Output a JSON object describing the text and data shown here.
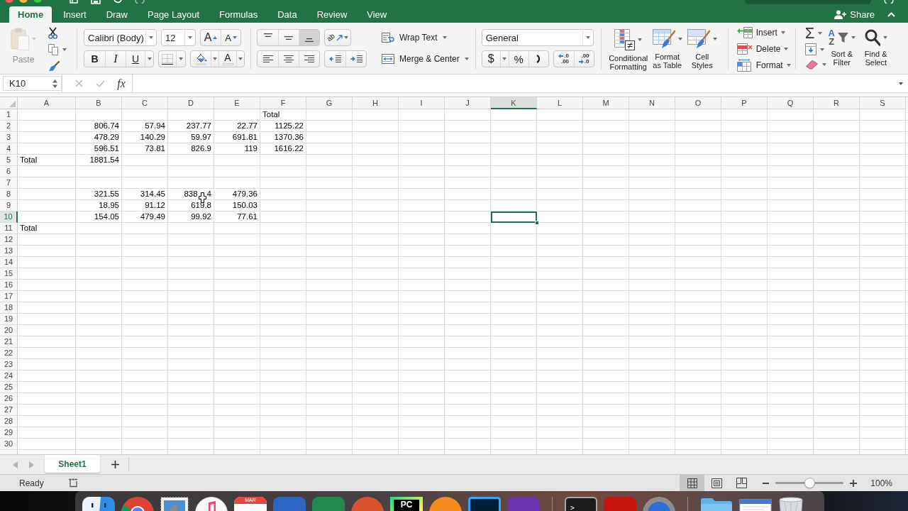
{
  "ribbon_tabs": [
    {
      "label": "Home",
      "selected": true
    },
    {
      "label": "Insert",
      "selected": false
    },
    {
      "label": "Draw",
      "selected": false
    },
    {
      "label": "Page Layout",
      "selected": false
    },
    {
      "label": "Formulas",
      "selected": false
    },
    {
      "label": "Data",
      "selected": false
    },
    {
      "label": "Review",
      "selected": false
    },
    {
      "label": "View",
      "selected": false
    }
  ],
  "share": {
    "label": "Share"
  },
  "ribbon": {
    "clipboard": {
      "paste": {
        "label": "Paste",
        "disabled": true
      }
    },
    "font": {
      "name": "Calibri (Body)",
      "size": "12",
      "grow": "A",
      "shrink": "A",
      "bold": "B",
      "italic": "I",
      "underline": "U",
      "font_color": "A"
    },
    "alignment": {
      "vertical": [
        {
          "kind": "top",
          "selected": false
        },
        {
          "kind": "middle",
          "selected": false
        },
        {
          "kind": "bottom",
          "selected": true
        }
      ],
      "orientation": "ab",
      "horizontal": [
        {
          "kind": "left",
          "selected": false
        },
        {
          "kind": "center",
          "selected": false
        },
        {
          "kind": "right",
          "selected": false
        }
      ],
      "wrap_text": "Wrap Text",
      "merge": "Merge & Center"
    },
    "number": {
      "format": "General",
      "currency": "$",
      "percent": "%",
      "decimals": [
        {
          "kind": "increase",
          "top": ".0",
          "bottom": ".00"
        },
        {
          "kind": "decrease",
          "top": ".00",
          "bottom": ".0"
        }
      ]
    },
    "styles": [
      {
        "kind": "conditional",
        "label": "Conditional Formatting"
      },
      {
        "kind": "table",
        "label": "Format as Table"
      },
      {
        "kind": "cell",
        "label": "Cell Styles"
      }
    ],
    "cells": [
      {
        "kind": "insert",
        "label": "Insert"
      },
      {
        "kind": "delete",
        "label": "Delete"
      },
      {
        "kind": "format",
        "label": "Format"
      }
    ],
    "editing": {
      "sum": "Σ",
      "sort": {
        "letters": [
          "A",
          "Z"
        ],
        "label": "Sort & Filter"
      },
      "find": {
        "label": "Find & Select"
      }
    }
  },
  "formula_bar": {
    "name_box": "K10",
    "cancel": {
      "disabled": true
    },
    "enter": {
      "disabled": true
    },
    "function_label": "fx"
  },
  "sheet": {
    "columns": [
      {
        "label": "A",
        "selected": false
      },
      {
        "label": "B",
        "selected": false
      },
      {
        "label": "C",
        "selected": false
      },
      {
        "label": "D",
        "selected": false
      },
      {
        "label": "E",
        "selected": false
      },
      {
        "label": "F",
        "selected": false
      },
      {
        "label": "G",
        "selected": false
      },
      {
        "label": "H",
        "selected": false
      },
      {
        "label": "I",
        "selected": false
      },
      {
        "label": "J",
        "selected": false
      },
      {
        "label": "K",
        "selected": true
      },
      {
        "label": "L",
        "selected": false
      },
      {
        "label": "M",
        "selected": false
      },
      {
        "label": "N",
        "selected": false
      },
      {
        "label": "O",
        "selected": false
      },
      {
        "label": "P",
        "selected": false
      },
      {
        "label": "Q",
        "selected": false
      },
      {
        "label": "R",
        "selected": false
      },
      {
        "label": "S",
        "selected": false
      }
    ],
    "rows": [
      {
        "label": "1",
        "selected": false,
        "cells": [
          null,
          null,
          null,
          null,
          null,
          {
            "value": "Total",
            "kind": "text"
          }
        ]
      },
      {
        "label": "2",
        "selected": false,
        "cells": [
          null,
          {
            "value": "806.74",
            "kind": "number"
          },
          {
            "value": "57.94",
            "kind": "number"
          },
          {
            "value": "237.77",
            "kind": "number"
          },
          {
            "value": "22.77",
            "kind": "number"
          },
          {
            "value": "1125.22",
            "kind": "number"
          }
        ]
      },
      {
        "label": "3",
        "selected": false,
        "cells": [
          null,
          {
            "value": "478.29",
            "kind": "number"
          },
          {
            "value": "140.29",
            "kind": "number"
          },
          {
            "value": "59.97",
            "kind": "number"
          },
          {
            "value": "691.81",
            "kind": "number"
          },
          {
            "value": "1370.36",
            "kind": "number"
          }
        ]
      },
      {
        "label": "4",
        "selected": false,
        "cells": [
          null,
          {
            "value": "596.51",
            "kind": "number"
          },
          {
            "value": "73.81",
            "kind": "number"
          },
          {
            "value": "826.9",
            "kind": "number"
          },
          {
            "value": "119",
            "kind": "number"
          },
          {
            "value": "1616.22",
            "kind": "number"
          }
        ]
      },
      {
        "label": "5",
        "selected": false,
        "cells": [
          {
            "value": "Total",
            "kind": "text"
          },
          {
            "value": "1881.54",
            "kind": "number"
          }
        ]
      },
      {
        "label": "6",
        "selected": false
      },
      {
        "label": "7",
        "selected": false
      },
      {
        "label": "8",
        "selected": false,
        "cells": [
          null,
          {
            "value": "321.55",
            "kind": "number"
          },
          {
            "value": "314.45",
            "kind": "number"
          },
          {
            "value_parts": [
              "838",
              "4"
            ],
            "kind": "number"
          },
          {
            "value": "479.36",
            "kind": "number"
          }
        ]
      },
      {
        "label": "9",
        "selected": false,
        "cells": [
          null,
          {
            "value": "18.95",
            "kind": "number"
          },
          {
            "value": "91.12",
            "kind": "number"
          },
          {
            "value": "619.8",
            "kind": "number"
          },
          {
            "value": "150.03",
            "kind": "number"
          }
        ]
      },
      {
        "label": "10",
        "selected": true,
        "cells": [
          null,
          {
            "value": "154.05",
            "kind": "number"
          },
          {
            "value": "479.49",
            "kind": "number"
          },
          {
            "value": "99.92",
            "kind": "number"
          },
          {
            "value": "77.61",
            "kind": "number"
          }
        ]
      },
      {
        "label": "11",
        "selected": false,
        "cells": [
          {
            "value": "Total",
            "kind": "text"
          }
        ]
      },
      {
        "label": "12",
        "selected": false
      },
      {
        "label": "13",
        "selected": false
      },
      {
        "label": "14",
        "selected": false
      },
      {
        "label": "15",
        "selected": false
      },
      {
        "label": "16",
        "selected": false
      },
      {
        "label": "17",
        "selected": false
      },
      {
        "label": "18",
        "selected": false
      },
      {
        "label": "19",
        "selected": false
      },
      {
        "label": "20",
        "selected": false
      },
      {
        "label": "21",
        "selected": false
      },
      {
        "label": "22",
        "selected": false
      },
      {
        "label": "23",
        "selected": false
      },
      {
        "label": "24",
        "selected": false
      },
      {
        "label": "25",
        "selected": false
      },
      {
        "label": "26",
        "selected": false
      },
      {
        "label": "27",
        "selected": false
      },
      {
        "label": "28",
        "selected": false
      },
      {
        "label": "29",
        "selected": false
      },
      {
        "label": "30",
        "selected": false
      }
    ]
  },
  "sheet_tabs": [
    {
      "label": "Sheet1",
      "selected": true
    }
  ],
  "status_bar": {
    "status": "Ready",
    "views": [
      {
        "kind": "normal",
        "selected": true
      },
      {
        "kind": "page-layout",
        "selected": false
      },
      {
        "kind": "page-break",
        "selected": false
      }
    ],
    "zoom": {
      "level": 0.5,
      "reading": "100%"
    }
  },
  "dock": [
    {
      "kind": "split"
    },
    {
      "kind": "ball"
    },
    {
      "kind": "stamp"
    },
    {
      "kind": "disc"
    },
    {
      "kind": "calendar",
      "label": "MAR"
    },
    {
      "kind": "tile",
      "color": "#2b65c4"
    },
    {
      "kind": "tile",
      "color": "#1f8a4c"
    },
    {
      "kind": "round",
      "color": "#d9532c"
    },
    {
      "kind": "badge",
      "label": "PC"
    },
    {
      "kind": "round",
      "color": "#f58a1f"
    },
    {
      "kind": "outline",
      "color": "#31a8ff"
    },
    {
      "kind": "tile",
      "color": "#6c33af"
    },
    {
      "kind": "divider"
    },
    {
      "kind": "terminal",
      "label": ">_"
    },
    {
      "kind": "tile",
      "color": "#c8140c"
    },
    {
      "kind": "ring"
    },
    {
      "kind": "divider"
    },
    {
      "kind": "folder"
    },
    {
      "kind": "window"
    },
    {
      "kind": "trash"
    }
  ]
}
